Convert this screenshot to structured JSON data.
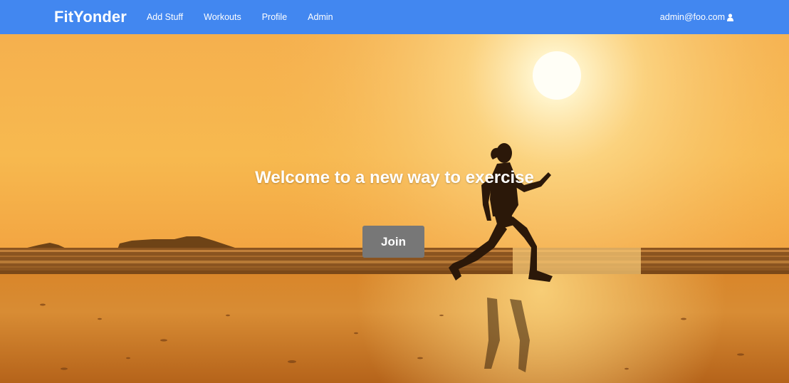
{
  "navbar": {
    "brand": "FitYonder",
    "links": [
      {
        "label": "Add Stuff"
      },
      {
        "label": "Workouts"
      },
      {
        "label": "Profile"
      },
      {
        "label": "Admin"
      }
    ],
    "user_email": "admin@foo.com",
    "user_icon": "user-icon",
    "color": "#4287f0"
  },
  "hero": {
    "title": "Welcome to a new way to exercise",
    "join_label": "Join",
    "join_color": "#777777"
  }
}
